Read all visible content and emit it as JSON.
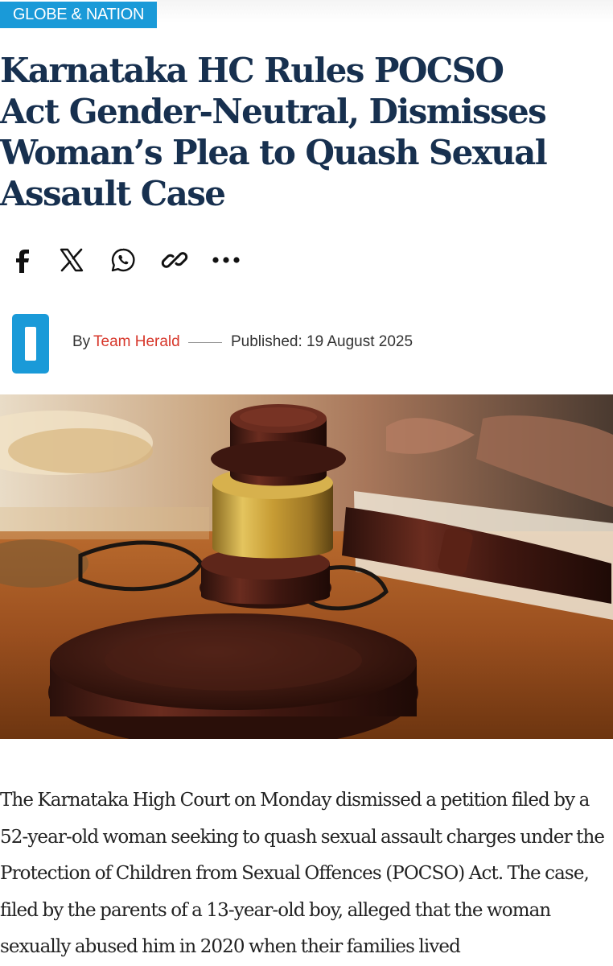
{
  "category": "GLOBE & NATION",
  "headline": "Karnataka HC Rules POCSO Act Gender-Neutral, Dismisses Woman’s Plea to Quash Sexual Assault Case",
  "share": [
    {
      "icon": "facebook-icon"
    },
    {
      "icon": "x-icon"
    },
    {
      "icon": "whatsapp-icon"
    },
    {
      "icon": "link-icon"
    },
    {
      "icon": "more-icon"
    }
  ],
  "byline": {
    "logo_letter": "O",
    "by_label": "By",
    "author": "Team Herald",
    "published": "Published: 19 August 2025"
  },
  "hero": {
    "subject": "judge-gavel-photo"
  },
  "article": {
    "paragraph": "The Karnataka High Court on Monday dismissed a petition filed by a 52-year-old woman seeking to quash sexual assault charges under the Protection of Children from Sexual Offences (POCSO) Act. The case, filed by the parents of a 13-year-old boy, alleged that the woman sexually abused him in 2020 when their families lived"
  },
  "colors": {
    "category_bg": "#1a9ad8",
    "headline": "#17304f",
    "author": "#d7372b",
    "logo": "#1a9ad8"
  }
}
